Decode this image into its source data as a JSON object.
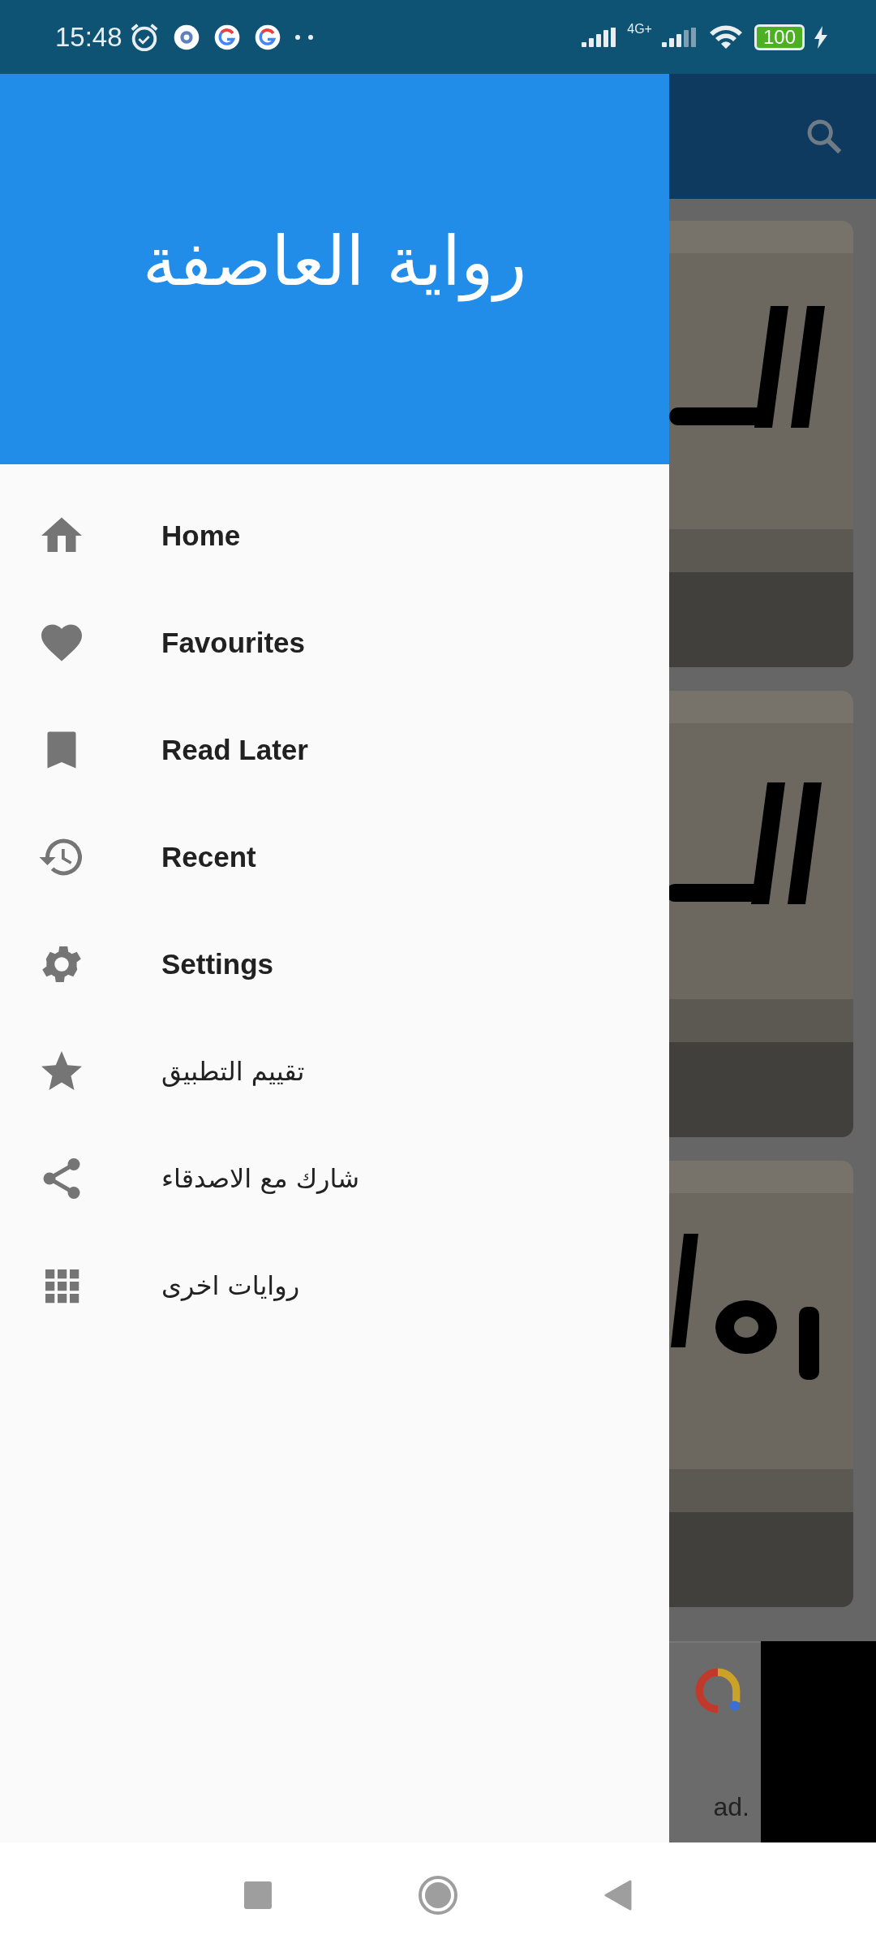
{
  "status_bar": {
    "time": "15:48",
    "network": "4G+",
    "battery": "100"
  },
  "drawer": {
    "title": "رواية العاصفة",
    "items": [
      {
        "label": "Home",
        "kind": "page"
      },
      {
        "label": "Favourites",
        "kind": "page"
      },
      {
        "label": "Read Later",
        "kind": "page"
      },
      {
        "label": "Recent",
        "kind": "page"
      },
      {
        "label": "Settings",
        "kind": "page"
      },
      {
        "label": "تقييم التطبيق",
        "kind": "action"
      },
      {
        "label": "شارك مع الاصدقاء",
        "kind": "action"
      },
      {
        "label": "روايات اخرى",
        "kind": "action"
      }
    ]
  },
  "ad": {
    "text": "ad."
  }
}
